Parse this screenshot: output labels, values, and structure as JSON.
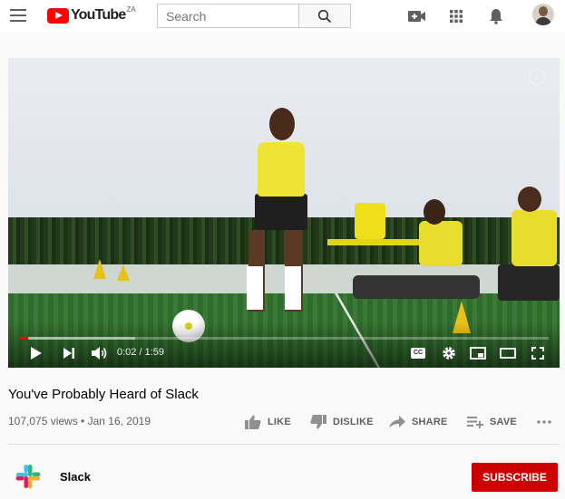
{
  "header": {
    "logo_text": "YouTube",
    "region": "ZA",
    "search_placeholder": "Search",
    "icons": [
      "menu-icon",
      "search-icon",
      "create-video-icon",
      "apps-grid-icon",
      "notifications-bell-icon",
      "account-avatar"
    ]
  },
  "player": {
    "time_current": "0:02",
    "time_separator": " / ",
    "time_total": "1:59",
    "progress_played": 0.017,
    "progress_buffered": 0.22,
    "info_label": "i",
    "cc_label": "CC",
    "controls": [
      "play-icon",
      "next-icon",
      "volume-icon",
      "captions-icon",
      "settings-icon",
      "miniplayer-icon",
      "theater-mode-icon",
      "fullscreen-icon"
    ]
  },
  "video": {
    "title": "You've Probably Heard of Slack",
    "views": "107,075 views",
    "date_separator": " • ",
    "date": "Jan 16, 2019"
  },
  "actions": {
    "like": "LIKE",
    "dislike": "DISLIKE",
    "share": "SHARE",
    "save": "SAVE"
  },
  "channel": {
    "name": "Slack",
    "subscribe": "SUBSCRIBE"
  },
  "colors": {
    "brand_red": "#ff0000",
    "subscribe_red": "#cc0000",
    "icon_gray": "#606060"
  }
}
